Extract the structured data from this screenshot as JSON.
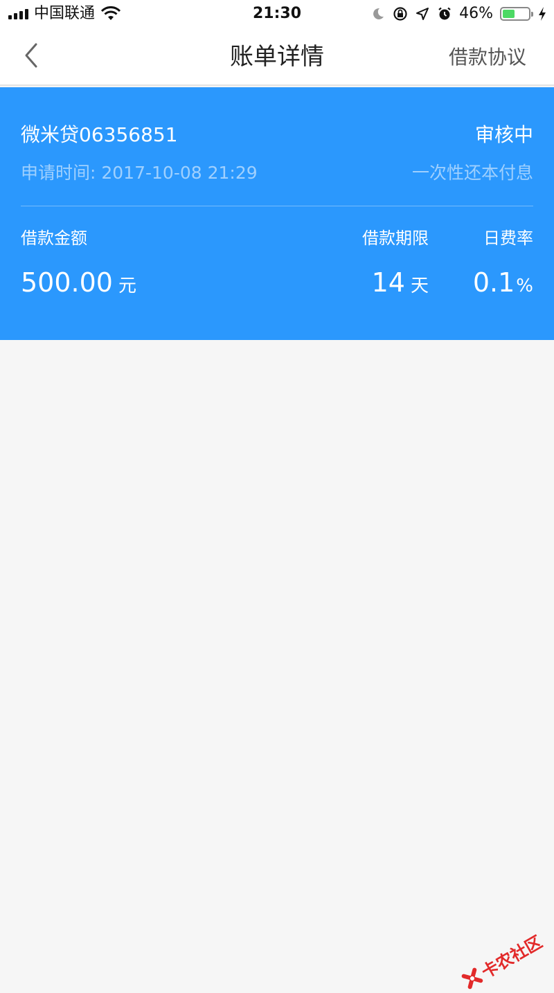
{
  "status_bar": {
    "carrier": "中国联通",
    "time": "21:30",
    "battery_percent": "46%",
    "battery_level": 0.46,
    "icons": [
      "signal-icon",
      "wifi-icon",
      "moon-icon",
      "rotation-lock-icon",
      "location-icon",
      "alarm-icon",
      "battery-icon",
      "charging-icon"
    ]
  },
  "nav": {
    "title": "账单详情",
    "action": "借款协议",
    "back_icon": "chevron-left-icon"
  },
  "bill": {
    "name": "微米贷06356851",
    "status": "审核中",
    "apply_time": "申请时间: 2017-10-08 21:29",
    "repay_type": "一次性还本付息",
    "amount_label": "借款金额",
    "amount_value": "500.00",
    "amount_unit": "元",
    "term_label": "借款期限",
    "term_value": "14",
    "term_unit": "天",
    "rate_label": "日费率",
    "rate_value": "0.1",
    "rate_unit": "%"
  },
  "watermark": {
    "text": "卡农社区"
  },
  "colors": {
    "accent": "#2b98fd",
    "background": "#f6f6f6",
    "battery_fill": "#4cd964",
    "watermark": "#e22a2a"
  }
}
